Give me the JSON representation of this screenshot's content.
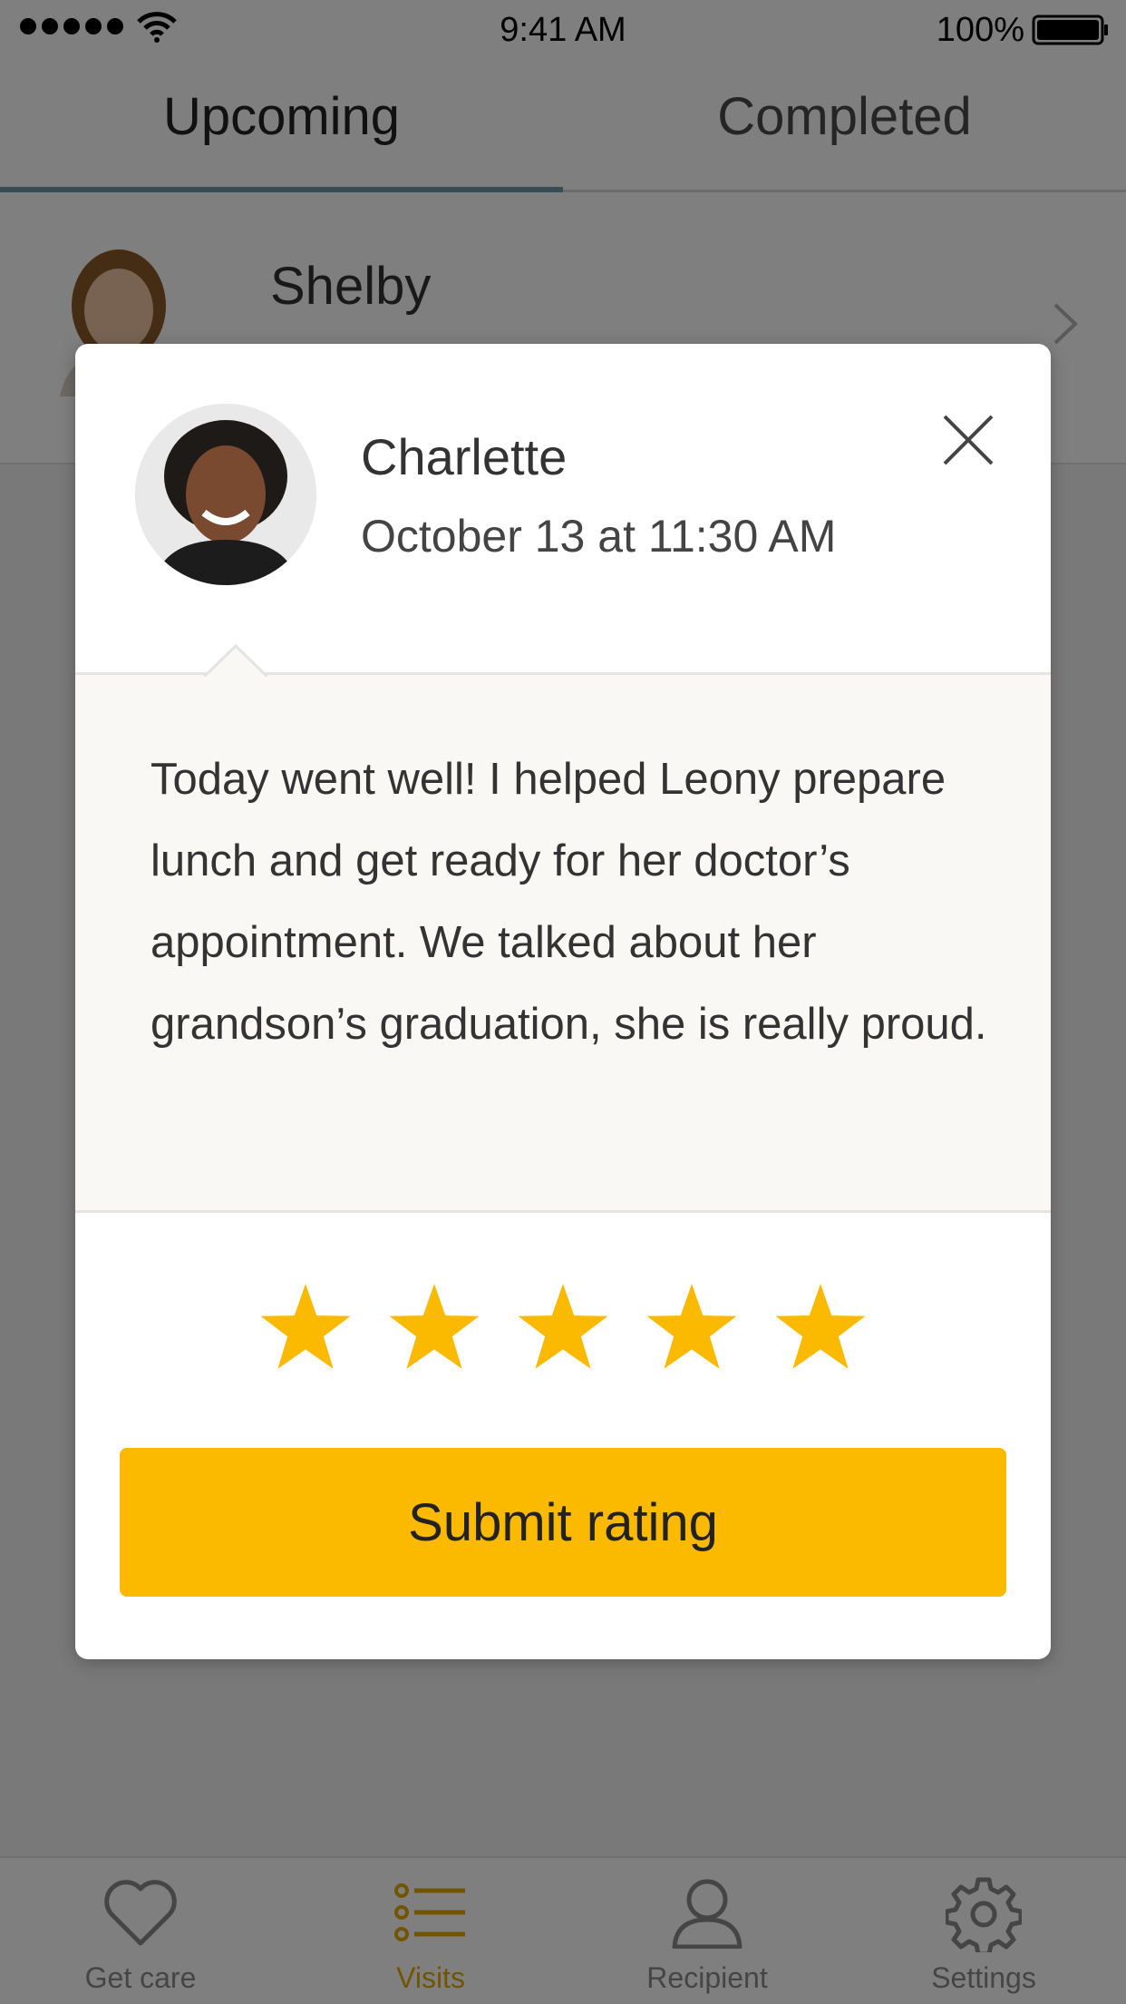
{
  "status_bar": {
    "time": "9:41 AM",
    "battery": "100%",
    "icons": [
      "signal-dots-icon",
      "wifi-icon",
      "battery-icon"
    ]
  },
  "tabs": [
    {
      "label": "Upcoming",
      "active": true
    },
    {
      "label": "Completed",
      "active": false
    }
  ],
  "list": {
    "items": [
      {
        "name": "Shelby"
      }
    ]
  },
  "modal": {
    "name": "Charlette",
    "date": "October 13 at 11:30 AM",
    "note": "Today went well! I helped Leony prepare lunch and get ready for her doctor’s appointment. We talked about her grandson’s graduation, she is really proud.",
    "rating": 5,
    "rating_max": 5,
    "submit_label": "Submit rating",
    "close_icon": "close-icon"
  },
  "bottom_nav": {
    "items": [
      {
        "label": "Get care",
        "icon": "heart-icon",
        "active": false
      },
      {
        "label": "Visits",
        "icon": "list-icon",
        "active": true
      },
      {
        "label": "Recipient",
        "icon": "person-icon",
        "active": false
      },
      {
        "label": "Settings",
        "icon": "gear-icon",
        "active": false
      }
    ]
  },
  "colors": {
    "accent": "#fbb900",
    "active_nav": "#e6a800",
    "tab_indicator": "#6f9aa8",
    "note_background": "#f9f8f4"
  }
}
